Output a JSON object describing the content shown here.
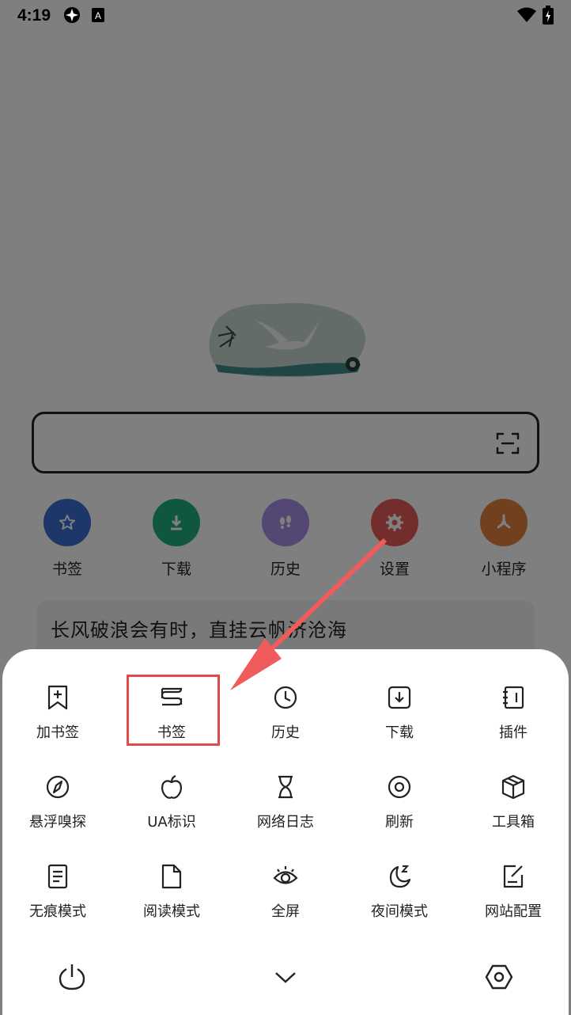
{
  "status_bar": {
    "time": "4:19",
    "icons": [
      "clock-app-icon",
      "font-app-icon",
      "wifi-icon",
      "battery-charging-icon"
    ]
  },
  "home": {
    "logo_icon": "seagull-ocean-logo",
    "search": {
      "value": "",
      "scan_icon": "scan-icon"
    },
    "quick_links": [
      {
        "label": "书签",
        "icon": "star-icon",
        "color": "#3a6fd0"
      },
      {
        "label": "下载",
        "icon": "download-icon",
        "color": "#1fb07a"
      },
      {
        "label": "历史",
        "icon": "footprints-icon",
        "color": "#a98ee8"
      },
      {
        "label": "设置",
        "icon": "gear-icon",
        "color": "#e85a5a"
      },
      {
        "label": "小程序",
        "icon": "mini-program-icon",
        "color": "#e3823f"
      }
    ],
    "quote": "长风破浪会有时，直挂云帆济沧海"
  },
  "menu": {
    "items": [
      {
        "label": "加书签",
        "icon": "add-bookmark-icon"
      },
      {
        "label": "书签",
        "icon": "bookmarks-icon"
      },
      {
        "label": "历史",
        "icon": "history-clock-icon"
      },
      {
        "label": "下载",
        "icon": "download-box-icon"
      },
      {
        "label": "插件",
        "icon": "plugin-icon"
      },
      {
        "label": "悬浮嗅探",
        "icon": "compass-icon"
      },
      {
        "label": "UA标识",
        "icon": "apple-icon"
      },
      {
        "label": "网络日志",
        "icon": "hourglass-icon"
      },
      {
        "label": "刷新",
        "icon": "refresh-ring-icon"
      },
      {
        "label": "工具箱",
        "icon": "toolbox-icon"
      },
      {
        "label": "无痕模式",
        "icon": "incognito-doc-icon"
      },
      {
        "label": "阅读模式",
        "icon": "reader-page-icon"
      },
      {
        "label": "全屏",
        "icon": "eye-icon"
      },
      {
        "label": "夜间模式",
        "icon": "moon-icon"
      },
      {
        "label": "网站配置",
        "icon": "site-config-icon"
      }
    ],
    "bottom": {
      "exit_icon": "power-icon",
      "collapse_icon": "chevron-down-icon",
      "settings_icon": "hexagon-settings-icon"
    },
    "highlight_color": "#e04b4b"
  }
}
